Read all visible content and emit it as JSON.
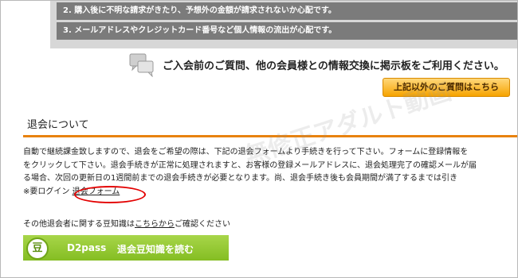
{
  "notices": [
    "2. 購入後に不明な請求がきたり、予想外の金額が請求されないか心配です。",
    "3. メールアドレスやクレジットカード番号など個人情報の流出が心配です。"
  ],
  "board": {
    "text": "ご入会前のご質問、他の会員様との情報交換に掲示板をご利用ください。",
    "button_label": "上記以外のご質問はこちら"
  },
  "section": {
    "title": "退会について",
    "lines": [
      "自動で継続課金致しますので、退会をご希望の際は、下記の退会フォームより手続きを行って下さい。フォームに登録情報を",
      "をクリックして下さい。退会手続きが正常に処理されますと、お客様の登録メールアドレスに、退会処理完了の確認メールが届",
      "る場合、次回の更新日の1週間前までの退会手続きが必要となります。尚、退会手続き後も会員期間が満了するまでは引き"
    ],
    "login_note": "※要ログイン",
    "form_link": "退会フォーム"
  },
  "other": {
    "prefix": "その他退会者に関する豆知識は",
    "link": "こちらから",
    "suffix": "ご確認ください"
  },
  "banner": {
    "icon_char": "豆",
    "brand": "D2pass",
    "label": "退会豆知識を読む"
  },
  "watermark": "無修正アダルト動画"
}
